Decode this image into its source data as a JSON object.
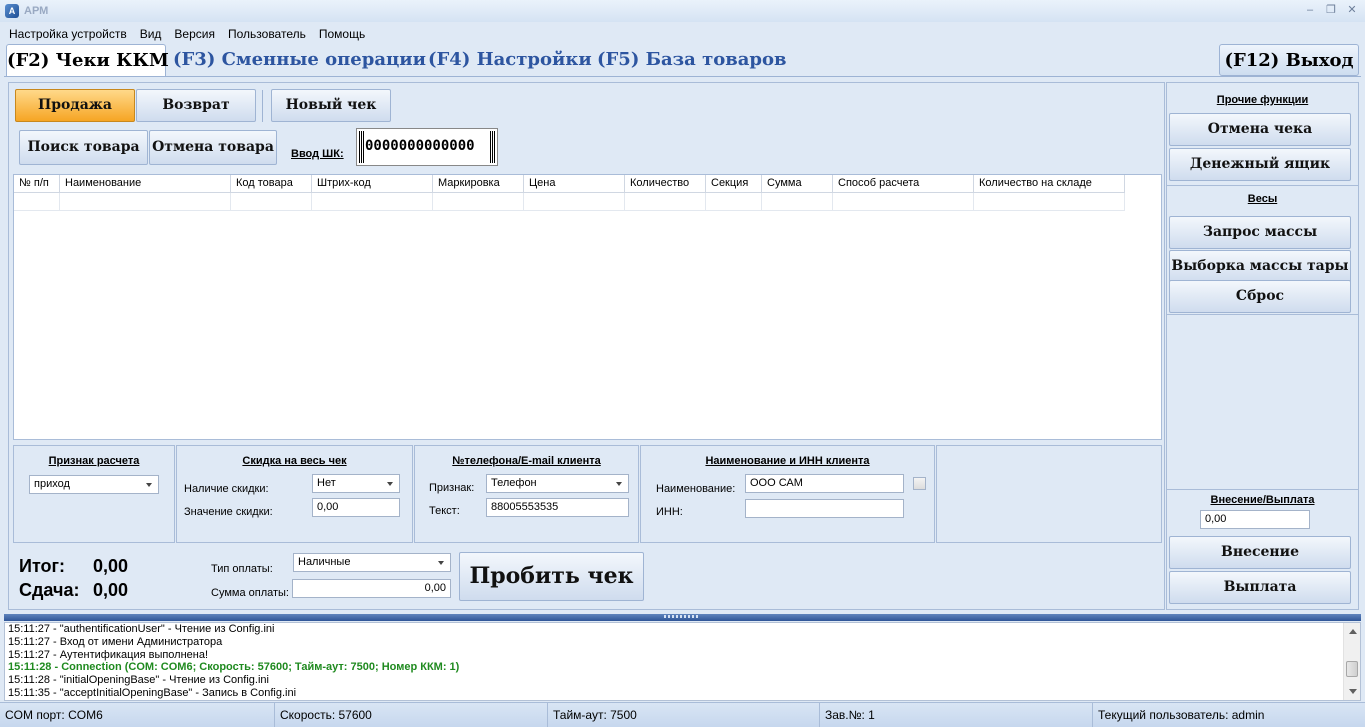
{
  "window": {
    "title": "АРМ"
  },
  "menu": [
    "Настройка устройств",
    "Вид",
    "Версия",
    "Пользователь",
    "Помощь"
  ],
  "tabs": {
    "active": "(F2) Чеки ККМ",
    "shifts": "(F3) Сменные операции",
    "settings": "(F4) Настройки",
    "goods": "(F5) База товаров",
    "exit": "(F12) Выход"
  },
  "toolbar": {
    "sale": "Продажа",
    "return": "Возврат",
    "new_check": "Новый чек",
    "search_goods": "Поиск товара",
    "cancel_goods": "Отмена товара",
    "barcode_label": "Ввод ШК:",
    "barcode_value": "0000000000000"
  },
  "table": {
    "columns": [
      "№ п/п",
      "Наименование",
      "Код товара",
      "Штрих-код",
      "Маркировка",
      "Цена",
      "Количество",
      "Секция",
      "Сумма",
      "Способ расчета",
      "Количество на складе"
    ]
  },
  "payment_sign": {
    "title": "Признак расчета",
    "value": "приход"
  },
  "discount": {
    "title": "Скидка на весь чек",
    "has_label": "Наличие скидки:",
    "has_value": "Нет",
    "value_label": "Значение скидки:",
    "value": "0,00"
  },
  "client_contact": {
    "title": "№телефона/E-mail клиента",
    "sign_label": "Признак:",
    "sign_value": "Телефон",
    "text_label": "Текст:",
    "text_value": "88005553535"
  },
  "client_info": {
    "title": "Наименование и ИНН клиента",
    "name_label": "Наименование:",
    "name_value": "ООО САМ",
    "inn_label": "ИНН:",
    "inn_value": ""
  },
  "totals": {
    "total_label": "Итог:",
    "total_value": "0,00",
    "change_label": "Сдача:",
    "change_value": "0,00",
    "pay_type_label": "Тип оплаты:",
    "pay_type_value": "Наличные",
    "pay_sum_label": "Сумма оплаты:",
    "pay_sum_value": "0,00",
    "print_button": "Пробить чек"
  },
  "sidebar": {
    "other_title": "Прочие функции",
    "cancel_check": "Отмена чека",
    "cash_drawer": "Денежный ящик",
    "scales_title": "Весы",
    "weight_request": "Запрос массы",
    "tare": "Выборка массы тары",
    "reset": "Сброс",
    "cash_io_title": "Внесение/Выплата",
    "cash_io_value": "0,00",
    "deposit": "Внесение",
    "payout": "Выплата"
  },
  "log": [
    "15:11:27 - \"authentificationUser\" - Чтение из Config.ini",
    "15:11:27 - Вход от имени Администратора",
    "15:11:27 - Аутентификация выполнена!",
    "15:11:28 - Connection (COM: COM6; Скорость: 57600; Тайм-аут: 7500; Номер ККМ: 1)",
    "15:11:28 - \"initialOpeningBase\" - Чтение из Config.ini",
    "15:11:35 - \"acceptInitialOpeningBase\" - Запись в Config.ini"
  ],
  "status": {
    "com": "COM порт: COM6",
    "speed": "Скорость: 57600",
    "timeout": "Тайм-аут: 7500",
    "serial": "Зав.№: 1",
    "user": "Текущий пользователь: admin"
  }
}
